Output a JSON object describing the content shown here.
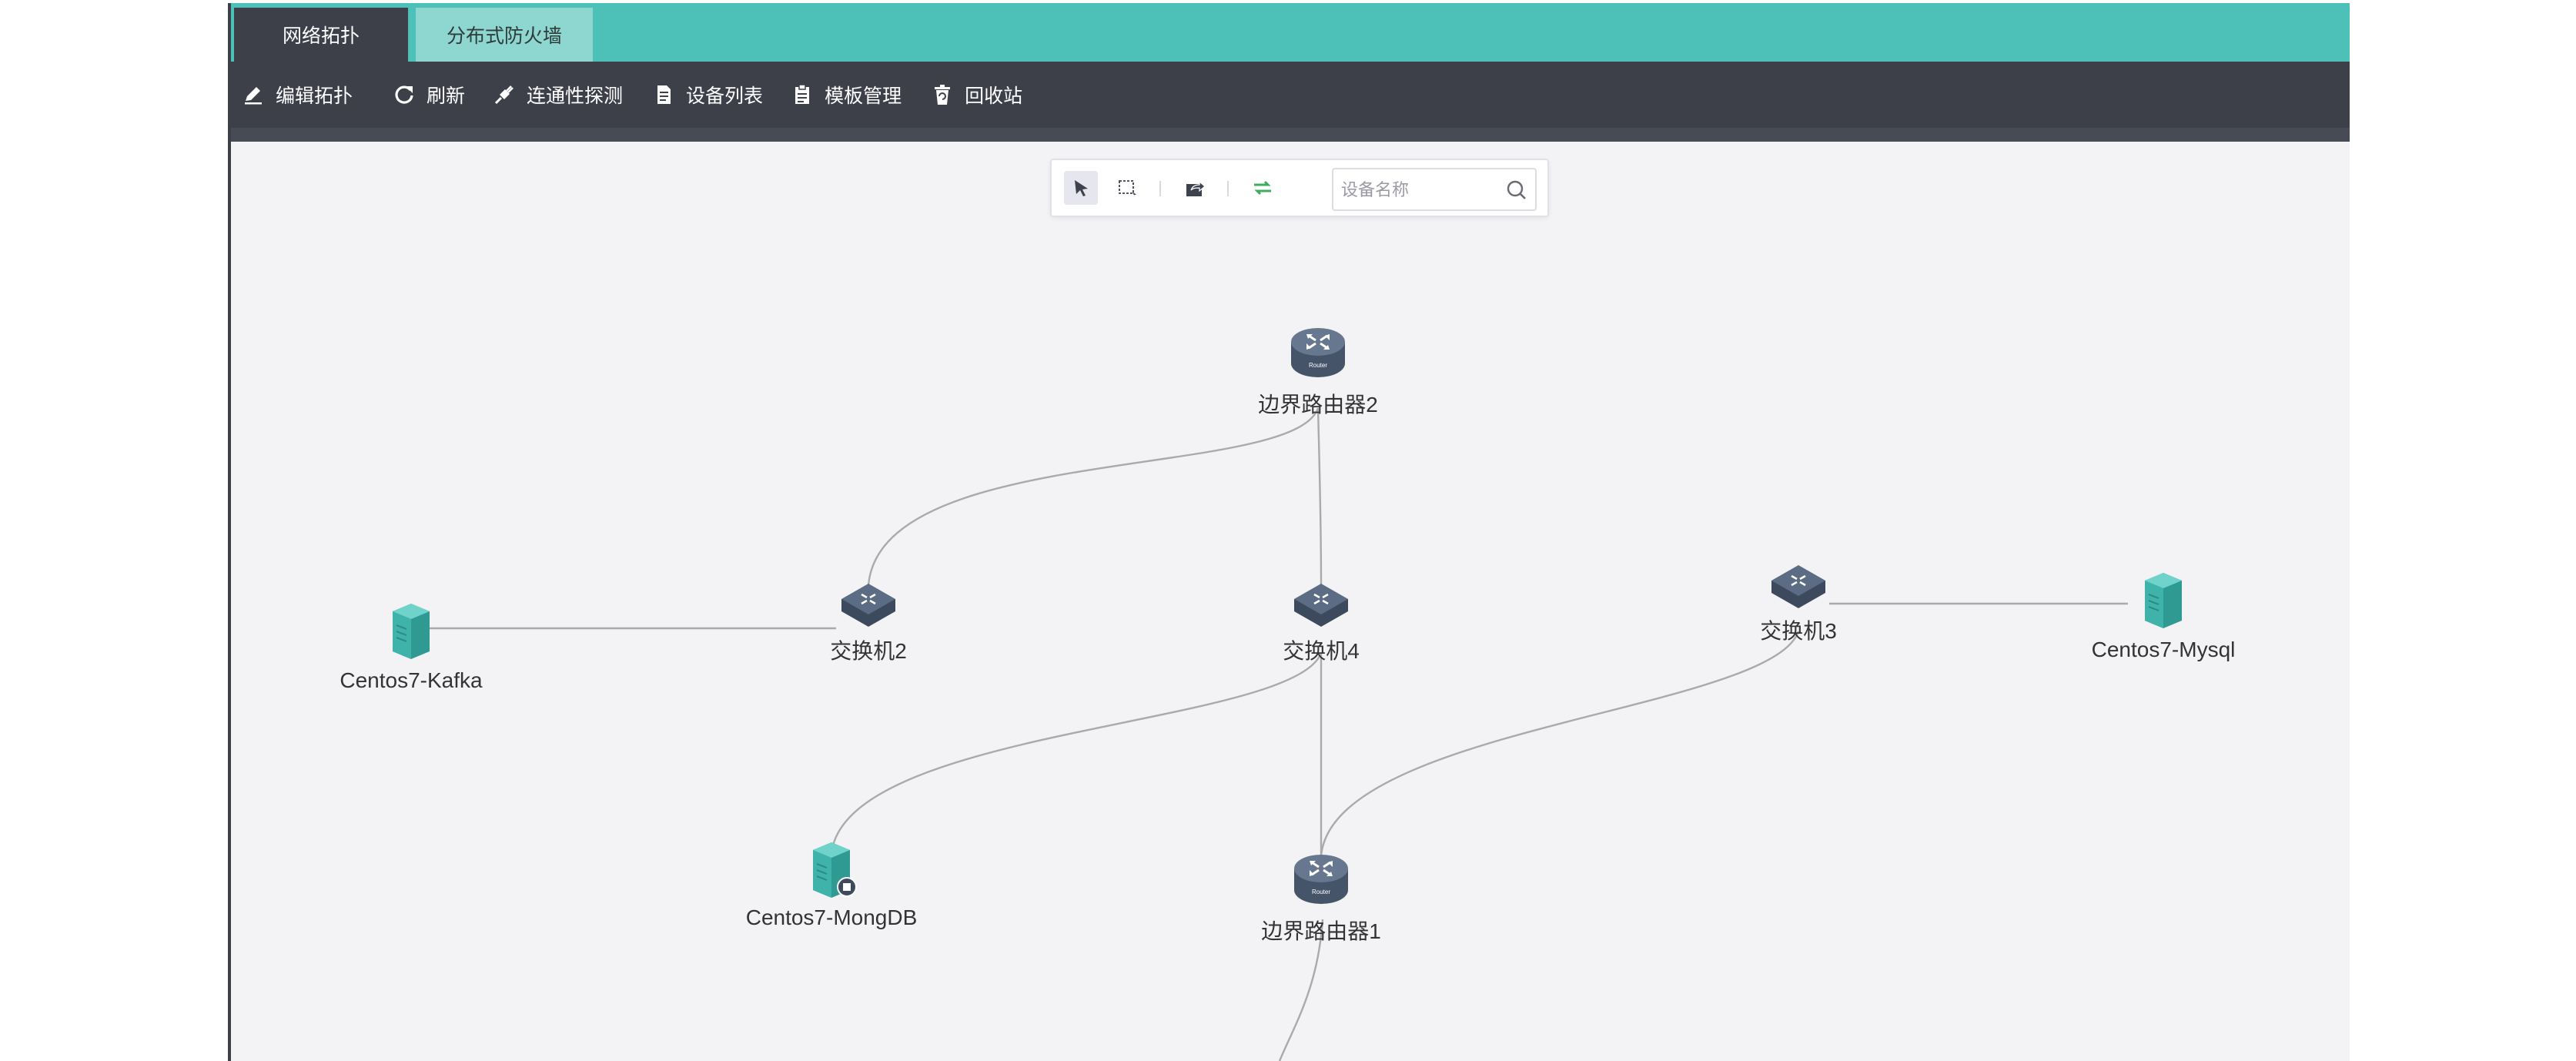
{
  "tabs": [
    {
      "label": "网络拓扑",
      "active": true
    },
    {
      "label": "分布式防火墙",
      "active": false
    }
  ],
  "toolbar": {
    "edit_topology": "编辑拓扑",
    "refresh": "刷新",
    "connectivity_probe": "连通性探测",
    "device_list": "设备列表",
    "template_management": "模板管理",
    "recycle_bin": "回收站"
  },
  "float_toolbar": {
    "tools": [
      "select-tool",
      "box-select-tool",
      "export-tool",
      "swap-tool"
    ],
    "search": {
      "placeholder": "设备名称",
      "value": ""
    }
  },
  "topology": {
    "nodes": [
      {
        "id": "r2",
        "label": "边界路由器2",
        "type": "router",
        "icon_text": "Router"
      },
      {
        "id": "sw2",
        "label": "交换机2",
        "type": "switch"
      },
      {
        "id": "sw4",
        "label": "交换机4",
        "type": "switch"
      },
      {
        "id": "sw3",
        "label": "交换机3",
        "type": "switch"
      },
      {
        "id": "kafka",
        "label": "Centos7-Kafka",
        "type": "server"
      },
      {
        "id": "mysql",
        "label": "Centos7-Mysql",
        "type": "server"
      },
      {
        "id": "mongodb",
        "label": "Centos7-MongDB",
        "type": "server-badge"
      },
      {
        "id": "r1",
        "label": "边界路由器1",
        "type": "router",
        "icon_text": "Router"
      }
    ],
    "links": [
      [
        "r2",
        "sw2"
      ],
      [
        "r2",
        "sw4"
      ],
      [
        "sw2",
        "kafka"
      ],
      [
        "sw4",
        "mongodb"
      ],
      [
        "sw4",
        "r1"
      ],
      [
        "sw3",
        "r1"
      ],
      [
        "sw3",
        "mysql"
      ],
      [
        "r1",
        "offscreen"
      ]
    ]
  },
  "colors": {
    "tab_bar": "#4dc1b8",
    "toolbar": "#3d4049",
    "canvas": "#f3f3f6",
    "device": "#4e5d73",
    "server": "#3fb3aa",
    "link": "#aaaaaa"
  }
}
